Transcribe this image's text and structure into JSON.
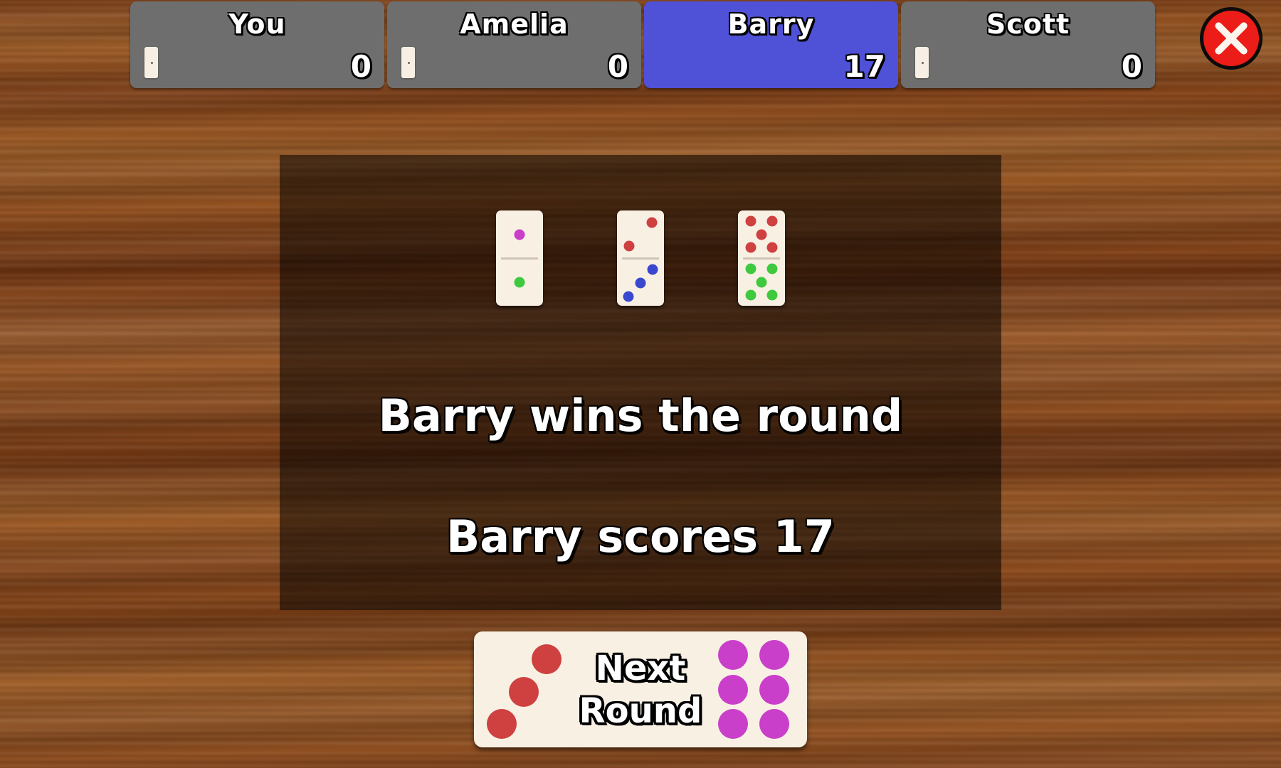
{
  "colors": {
    "wood_light": "#9c5c27",
    "wood_dark": "#6b3210",
    "panel_grey": "#6e6e6e",
    "panel_active_blue": "#4f51d6",
    "domino_face": "#f9f0e4",
    "pip_red": "#cf4040",
    "pip_green": "#3fc93f",
    "pip_blue": "#3a48cf",
    "pip_magenta": "#c93fc9",
    "close_red": "#ec1c18",
    "text_white": "#ffffff",
    "overlay_black": "rgba(0,0,0,0.52)"
  },
  "scorebar": {
    "players": [
      {
        "name": "You",
        "score": "0",
        "active": false,
        "has_hand_icon": true
      },
      {
        "name": "Amelia",
        "score": "0",
        "active": false,
        "has_hand_icon": true
      },
      {
        "name": "Barry",
        "score": "17",
        "active": true,
        "has_hand_icon": false
      },
      {
        "name": "Scott",
        "score": "0",
        "active": false,
        "has_hand_icon": true
      }
    ]
  },
  "close_button": {
    "icon": "close-x-icon",
    "label": "Close"
  },
  "message_panel": {
    "headline_1": "Barry wins the round",
    "headline_2": "Barry scores 17",
    "dominoes": [
      {
        "name": "domino-1-1",
        "top": {
          "value": 1,
          "color": "#c93fc9"
        },
        "bottom": {
          "value": 1,
          "color": "#3fc93f"
        }
      },
      {
        "name": "domino-2-3",
        "top": {
          "value": 2,
          "color": "#cf4040"
        },
        "bottom": {
          "value": 3,
          "color": "#3a48cf"
        }
      },
      {
        "name": "domino-5-5",
        "top": {
          "value": 5,
          "color": "#cf4040"
        },
        "bottom": {
          "value": 5,
          "color": "#3fc93f"
        }
      }
    ]
  },
  "next_button": {
    "line_1": "Next",
    "line_2": "Round",
    "left_pips": {
      "value": 3,
      "color": "#cf4040"
    },
    "right_pips": {
      "value": 6,
      "color": "#c93fc9"
    }
  }
}
